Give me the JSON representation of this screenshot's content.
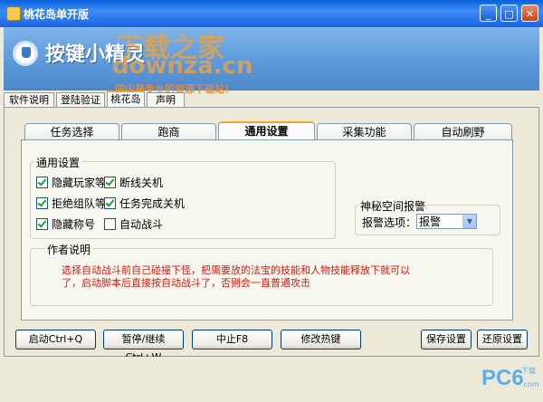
{
  "window": {
    "title": "桃花岛单开版"
  },
  "banner": {
    "logo_text": "按键小精灵",
    "watermark_line1": "下载之家",
    "watermark_line2": "downza.cn",
    "watermark_line3": "国内最专业的资源下载站！"
  },
  "outer_tabs": [
    "软件说明",
    "登陆验证",
    "桃花岛",
    "声明"
  ],
  "inner_tabs": [
    "任务选择",
    "跑商",
    "通用设置",
    "采集功能",
    "自动刷野"
  ],
  "general": {
    "legend": "通用设置",
    "options": [
      {
        "label": "隐藏玩家等",
        "checked": true
      },
      {
        "label": "断线关机",
        "checked": true
      },
      {
        "label": "拒绝组队等",
        "checked": true
      },
      {
        "label": "任务完成关机",
        "checked": true
      },
      {
        "label": "隐藏称号",
        "checked": true
      },
      {
        "label": "自动战斗",
        "checked": false
      }
    ]
  },
  "alarm": {
    "legend": "神秘空间报警",
    "label": "报警选项：",
    "value": "报警"
  },
  "author": {
    "legend": "作者说明",
    "text": "选择自动战斗前自己碰撞下怪，把需要放的法宝的技能和人物技能释放下就可以了，启动脚本后直接按自动战斗了，否则会一直普通攻击"
  },
  "buttons": {
    "start": "启动Ctrl+Q",
    "pause": "暂停/继续Ctrl+W",
    "stop": "中止F8",
    "hotkey": "修改热键",
    "save": "保存设置",
    "restore": "还原设置"
  },
  "footer": {
    "brand": "PC6",
    "sub1": "下载",
    "sub2": ".com"
  },
  "colors": {
    "accent_tab": "#f1a52f",
    "title_blue": "#0a5fdc",
    "author_text": "#e0190f"
  }
}
